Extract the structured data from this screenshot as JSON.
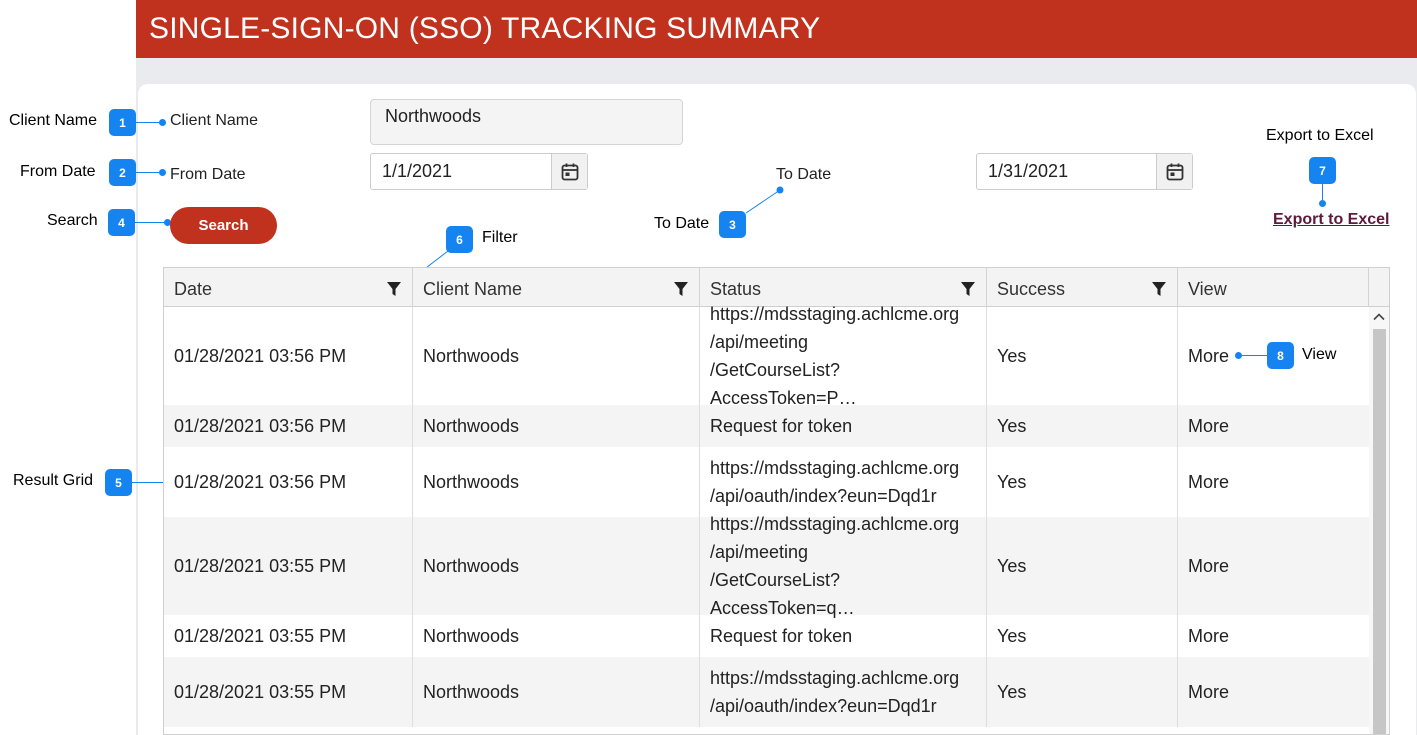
{
  "header": {
    "title": "SINGLE-SIGN-ON (SSO) TRACKING SUMMARY"
  },
  "form": {
    "client_name_label": "Client Name",
    "client_name_value": "Northwoods",
    "from_date_label": "From Date",
    "from_date_value": "1/1/2021",
    "to_date_label": "To Date",
    "to_date_value": "1/31/2021",
    "search_label": "Search",
    "export_label": "Export to Excel"
  },
  "annotations": [
    {
      "num": "1",
      "text": "Client Name"
    },
    {
      "num": "2",
      "text": "From Date"
    },
    {
      "num": "3",
      "text": "To Date"
    },
    {
      "num": "4",
      "text": "Search"
    },
    {
      "num": "5",
      "text": "Result Grid"
    },
    {
      "num": "6",
      "text": "Filter"
    },
    {
      "num": "7",
      "text": "Export to Excel"
    },
    {
      "num": "8",
      "text": "View"
    }
  ],
  "grid": {
    "columns": [
      "Date",
      "Client Name",
      "Status",
      "Success",
      "View"
    ],
    "rows": [
      {
        "date": "01/28/2021 03:56 PM",
        "client": "Northwoods",
        "status": "https://mdsstaging.achlcme.org\n/api/meeting\n/GetCourseList?AccessToken=P…",
        "success": "Yes",
        "view": "More"
      },
      {
        "date": "01/28/2021 03:56 PM",
        "client": "Northwoods",
        "status": "Request for token",
        "success": "Yes",
        "view": "More"
      },
      {
        "date": "01/28/2021 03:56 PM",
        "client": "Northwoods",
        "status": "https://mdsstaging.achlcme.org\n/api/oauth/index?eun=Dqd1r",
        "success": "Yes",
        "view": "More"
      },
      {
        "date": "01/28/2021 03:55 PM",
        "client": "Northwoods",
        "status": "https://mdsstaging.achlcme.org\n/api/meeting\n/GetCourseList?AccessToken=q…",
        "success": "Yes",
        "view": "More"
      },
      {
        "date": "01/28/2021 03:55 PM",
        "client": "Northwoods",
        "status": "Request for token",
        "success": "Yes",
        "view": "More"
      },
      {
        "date": "01/28/2021 03:55 PM",
        "client": "Northwoods",
        "status": "https://mdsstaging.achlcme.org\n/api/oauth/index?eun=Dqd1r",
        "success": "Yes",
        "view": "More"
      }
    ]
  },
  "colors": {
    "brand": "#c0311e",
    "annotation": "#1684f0",
    "link": "#5c1a3c"
  },
  "icons": {
    "calendar": "calendar-icon",
    "filter": "filter-icon",
    "scroll_up": "chevron-up-icon"
  }
}
